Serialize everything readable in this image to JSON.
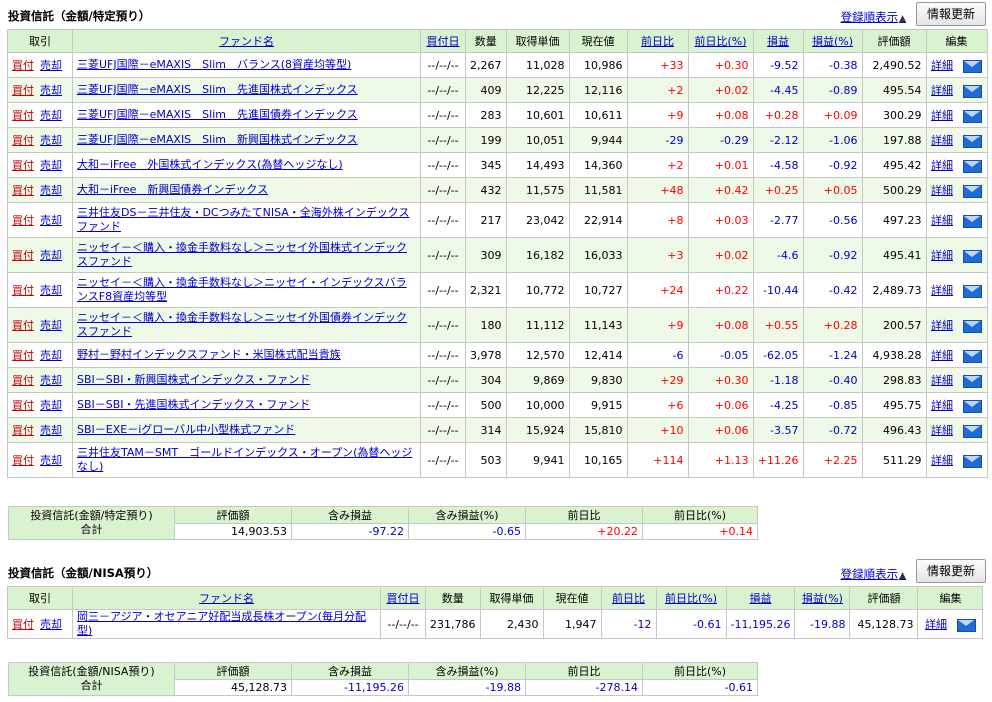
{
  "section1": {
    "title": "投資信託（金額/特定預り）",
    "sort_link": "登録順表示",
    "refresh": "情報更新",
    "headers": [
      "取引",
      "ファンド名",
      "買付日",
      "数量",
      "取得単価",
      "現在値",
      "前日比",
      "前日比(%)",
      "損益",
      "損益(%)",
      "評価額",
      "編集"
    ],
    "rows": [
      {
        "fund": "三菱UFJ国際－eMAXIS　Slim　バランス(8資産均等型)",
        "date": "--/--/--",
        "qty": "2,267",
        "cost": "11,028",
        "price": "10,986",
        "chg": "+33",
        "chgp": "+0.30",
        "pl": "-9.52",
        "plp": "-0.38",
        "val": "2,490.52"
      },
      {
        "fund": "三菱UFJ国際－eMAXIS　Slim　先進国株式インデックス",
        "date": "--/--/--",
        "qty": "409",
        "cost": "12,225",
        "price": "12,116",
        "chg": "+2",
        "chgp": "+0.02",
        "pl": "-4.45",
        "plp": "-0.89",
        "val": "495.54"
      },
      {
        "fund": "三菱UFJ国際－eMAXIS　Slim　先進国債券インデックス",
        "date": "--/--/--",
        "qty": "283",
        "cost": "10,601",
        "price": "10,611",
        "chg": "+9",
        "chgp": "+0.08",
        "pl": "+0.28",
        "plp": "+0.09",
        "val": "300.29"
      },
      {
        "fund": "三菱UFJ国際－eMAXIS　Slim　新興国株式インデックス",
        "date": "--/--/--",
        "qty": "199",
        "cost": "10,051",
        "price": "9,944",
        "chg": "-29",
        "chgp": "-0.29",
        "pl": "-2.12",
        "plp": "-1.06",
        "val": "197.88"
      },
      {
        "fund": "大和－iFree　外国株式インデックス(為替ヘッジなし)",
        "date": "--/--/--",
        "qty": "345",
        "cost": "14,493",
        "price": "14,360",
        "chg": "+2",
        "chgp": "+0.01",
        "pl": "-4.58",
        "plp": "-0.92",
        "val": "495.42"
      },
      {
        "fund": "大和－iFree　新興国債券インデックス",
        "date": "--/--/--",
        "qty": "432",
        "cost": "11,575",
        "price": "11,581",
        "chg": "+48",
        "chgp": "+0.42",
        "pl": "+0.25",
        "plp": "+0.05",
        "val": "500.29"
      },
      {
        "fund": "三井住友DS－三井住友・DCつみたてNISA・全海外株インデックスファンド",
        "date": "--/--/--",
        "qty": "217",
        "cost": "23,042",
        "price": "22,914",
        "chg": "+8",
        "chgp": "+0.03",
        "pl": "-2.77",
        "plp": "-0.56",
        "val": "497.23"
      },
      {
        "fund": "ニッセイ－＜購入・換金手数料なし＞ニッセイ外国株式インデックスファンド",
        "date": "--/--/--",
        "qty": "309",
        "cost": "16,182",
        "price": "16,033",
        "chg": "+3",
        "chgp": "+0.02",
        "pl": "-4.6",
        "plp": "-0.92",
        "val": "495.41"
      },
      {
        "fund": "ニッセイ－＜購入・換金手数料なし＞ニッセイ・インデックスバランスF8資産均等型",
        "date": "--/--/--",
        "qty": "2,321",
        "cost": "10,772",
        "price": "10,727",
        "chg": "+24",
        "chgp": "+0.22",
        "pl": "-10.44",
        "plp": "-0.42",
        "val": "2,489.73"
      },
      {
        "fund": "ニッセイ－＜購入・換金手数料なし＞ニッセイ外国債券インデックスファンド",
        "date": "--/--/--",
        "qty": "180",
        "cost": "11,112",
        "price": "11,143",
        "chg": "+9",
        "chgp": "+0.08",
        "pl": "+0.55",
        "plp": "+0.28",
        "val": "200.57"
      },
      {
        "fund": "野村－野村インデックスファンド・米国株式配当貴族",
        "date": "--/--/--",
        "qty": "3,978",
        "cost": "12,570",
        "price": "12,414",
        "chg": "-6",
        "chgp": "-0.05",
        "pl": "-62.05",
        "plp": "-1.24",
        "val": "4,938.28"
      },
      {
        "fund": "SBI－SBI・新興国株式インデックス・ファンド",
        "date": "--/--/--",
        "qty": "304",
        "cost": "9,869",
        "price": "9,830",
        "chg": "+29",
        "chgp": "+0.30",
        "pl": "-1.18",
        "plp": "-0.40",
        "val": "298.83"
      },
      {
        "fund": "SBI－SBI・先進国株式インデックス・ファンド",
        "date": "--/--/--",
        "qty": "500",
        "cost": "10,000",
        "price": "9,915",
        "chg": "+6",
        "chgp": "+0.06",
        "pl": "-4.25",
        "plp": "-0.85",
        "val": "495.75"
      },
      {
        "fund": "SBI－EXE－iグローバル中小型株式ファンド",
        "date": "--/--/--",
        "qty": "314",
        "cost": "15,924",
        "price": "15,810",
        "chg": "+10",
        "chgp": "+0.06",
        "pl": "-3.57",
        "plp": "-0.72",
        "val": "496.43"
      },
      {
        "fund": "三井住友TAM－SMT　ゴールドインデックス・オープン(為替ヘッジなし)",
        "date": "--/--/--",
        "qty": "503",
        "cost": "9,941",
        "price": "10,165",
        "chg": "+114",
        "chgp": "+1.13",
        "pl": "+11.26",
        "plp": "+2.25",
        "val": "511.29"
      }
    ],
    "summary": {
      "label1": "投資信託(金額/特定預り)",
      "label2": "合計",
      "headers": [
        "評価額",
        "含み損益",
        "含み損益(%)",
        "前日比",
        "前日比(%)"
      ],
      "values": [
        "14,903.53",
        "-97.22",
        "-0.65",
        "+20.22",
        "+0.14"
      ]
    }
  },
  "section2": {
    "title": "投資信託（金額/NISA預り）",
    "sort_link": "登録順表示",
    "refresh": "情報更新",
    "headers": [
      "取引",
      "ファンド名",
      "買付日",
      "数量",
      "取得単価",
      "現在値",
      "前日比",
      "前日比(%)",
      "損益",
      "損益(%)",
      "評価額",
      "編集"
    ],
    "rows": [
      {
        "fund": "岡三－アジア・オセアニア好配当成長株オープン(毎月分配型)",
        "date": "--/--/--",
        "qty": "231,786",
        "cost": "2,430",
        "price": "1,947",
        "chg": "-12",
        "chgp": "-0.61",
        "pl": "-11,195.26",
        "plp": "-19.88",
        "val": "45,128.73"
      }
    ],
    "summary": {
      "label1": "投資信託(金額/NISA預り)",
      "label2": "合計",
      "headers": [
        "評価額",
        "含み損益",
        "含み損益(%)",
        "前日比",
        "前日比(%)"
      ],
      "values": [
        "45,128.73",
        "-11,195.26",
        "-19.88",
        "-278.14",
        "-0.61"
      ]
    }
  },
  "labels": {
    "buy": "買付",
    "sell": "売却",
    "detail": "詳細"
  },
  "icons": {
    "sort": "triangle-up-icon",
    "edit_mail": "mail-icon"
  },
  "colors": {
    "header_bg": "#d9f2cf",
    "row_alt_bg": "#eef9e7",
    "positive": "#ff0000",
    "negative": "#0000cc",
    "link": "#0000cc"
  }
}
